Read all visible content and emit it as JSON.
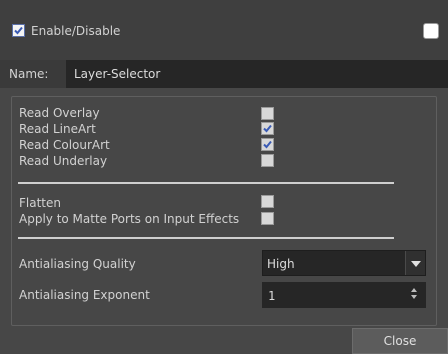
{
  "header": {
    "enable_label": "Enable/Disable",
    "enable_checked": true
  },
  "name_field": {
    "label": "Name:",
    "value": "Layer-Selector"
  },
  "options": {
    "read_overlay": "Read Overlay",
    "read_lineart": "Read LineArt",
    "read_colourart": "Read ColourArt",
    "read_underlay": "Read Underlay",
    "flatten": "Flatten",
    "apply_matte": "Apply to Matte Ports on Input Effects",
    "states": {
      "read_overlay": false,
      "read_lineart": true,
      "read_colourart": true,
      "read_underlay": false,
      "flatten": false,
      "apply_matte": false
    }
  },
  "antialiasing": {
    "quality_label": "Antialiasing Quality",
    "quality_value": "High",
    "exponent_label": "Antialiasing Exponent",
    "exponent_value": "1"
  },
  "footer": {
    "close_label": "Close"
  },
  "colors": {
    "background": "#474747",
    "input_bg": "#262626",
    "checkbox_check": "#3a5bb5"
  }
}
